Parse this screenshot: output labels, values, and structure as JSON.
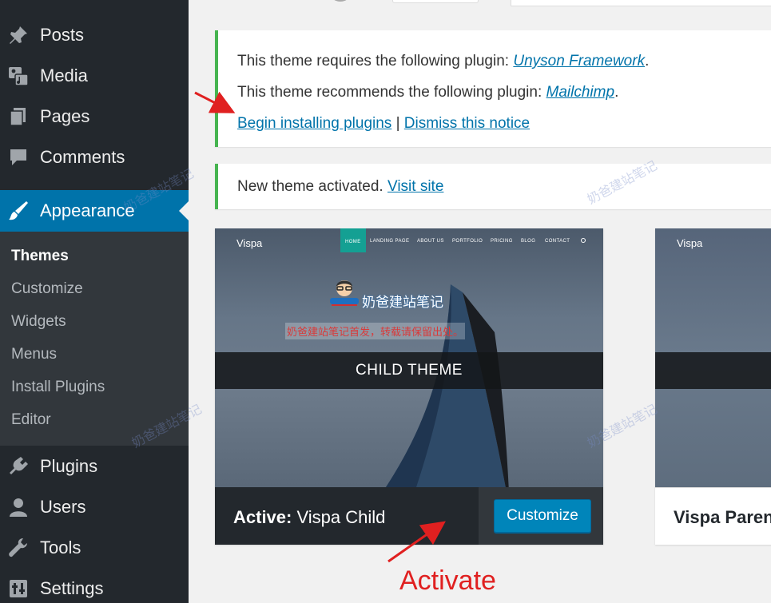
{
  "sidebar": {
    "items": [
      {
        "label": "Posts",
        "icon": "pushpin-icon"
      },
      {
        "label": "Media",
        "icon": "media-icon"
      },
      {
        "label": "Pages",
        "icon": "pages-icon"
      },
      {
        "label": "Comments",
        "icon": "comment-icon"
      },
      {
        "label": "Appearance",
        "icon": "paintbrush-icon",
        "current": true
      },
      {
        "label": "Plugins",
        "icon": "plugin-icon"
      },
      {
        "label": "Users",
        "icon": "user-icon"
      },
      {
        "label": "Tools",
        "icon": "wrench-icon"
      },
      {
        "label": "Settings",
        "icon": "settings-icon"
      }
    ],
    "submenu": [
      {
        "label": "Themes",
        "active": true
      },
      {
        "label": "Customize"
      },
      {
        "label": "Widgets"
      },
      {
        "label": "Menus"
      },
      {
        "label": "Install Plugins"
      },
      {
        "label": "Editor"
      }
    ],
    "colors": {
      "bg": "#23282d",
      "submenu_bg": "#32373c",
      "current": "#0073aa"
    }
  },
  "notices": {
    "plugins": {
      "required_text": "This theme requires the following plugin: ",
      "required_plugin": "Unyson Framework",
      "recommended_text": "This theme recommends the following plugin: ",
      "recommended_plugin": "Mailchimp",
      "period": ".",
      "begin_link": "Begin installing plugins",
      "separator": " | ",
      "dismiss_link": "Dismiss this notice"
    },
    "activated": {
      "text": "New theme activated. ",
      "link": "Visit site"
    }
  },
  "themes": {
    "active": {
      "screenshot": {
        "logo": "Vispa",
        "menu": [
          "HOME",
          "LANDING PAGE",
          "ABOUT US",
          "PORTFOLIO",
          "PRICING",
          "BLOG",
          "CONTACT"
        ],
        "band_text": "CHILD THEME"
      },
      "active_prefix": "Active:",
      "name": " Vispa Child",
      "customize_label": "Customize"
    },
    "parent": {
      "screenshot_logo": "Vispa",
      "name": "Vispa Parent"
    }
  },
  "watermark": {
    "text": "奶爸建站笔记",
    "subtext": "奶爸建站笔记首发，转载请保留出处。"
  },
  "annotation": {
    "label": "Activate",
    "color": "#e02020"
  }
}
